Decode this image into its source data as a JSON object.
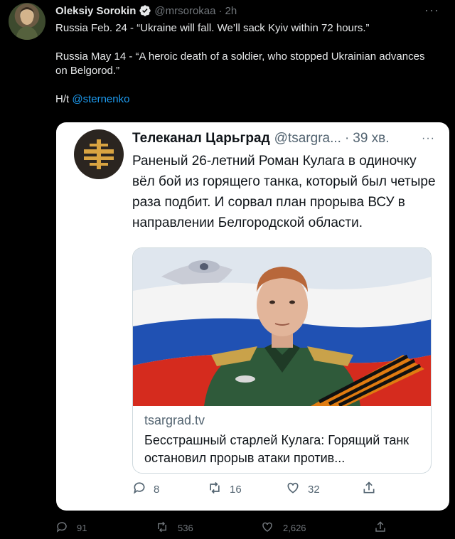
{
  "tweet": {
    "author_name": "Oleksiy Sorokin",
    "handle": "@mrsorokaa",
    "separator": "·",
    "time": "2h",
    "more": "···",
    "line1": "Russia Feb. 24 - “Ukraine will fall. We’ll sack Kyiv within 72 hours.”",
    "line2": "Russia May 14 - “A heroic death of a soldier, who stopped Ukrainian advances on Belgorod.”",
    "ht_prefix": "H/t ",
    "ht_mention": "@sternenko",
    "stats": {
      "replies": "91",
      "retweets": "536",
      "likes": "2,626"
    }
  },
  "quote": {
    "author_name": "Телеканал Царьград",
    "handle": "@tsargra...",
    "separator": "·",
    "time": "39 хв.",
    "more": "···",
    "text": "Раненый 26-летний Роман Кулага  в одиночку вёл бой из горящего танка, который был четыре раза подбит.  И сорвал план прорыва ВСУ в направлении Белгородской области.",
    "link_card": {
      "domain": "tsargrad.tv",
      "title": "Бесстрашный старлей Кулага: Горящий танк остановил прорыв атаки против..."
    },
    "stats": {
      "replies": "8",
      "retweets": "16",
      "likes": "32"
    }
  },
  "colors": {
    "background": "#000000",
    "link_blue": "#1d9bf0",
    "verified": "#e7e9ea",
    "muted_dark": "#71767b",
    "muted_light": "#536471",
    "flag_white": "#f4f4f4",
    "flag_blue": "#2051b3",
    "flag_red": "#d52b1e",
    "ribbon_orange": "#e07b10"
  },
  "icons": {
    "verified": "verified-badge-icon",
    "reply": "reply-icon",
    "retweet": "retweet-icon",
    "like": "heart-icon",
    "share": "share-icon"
  }
}
